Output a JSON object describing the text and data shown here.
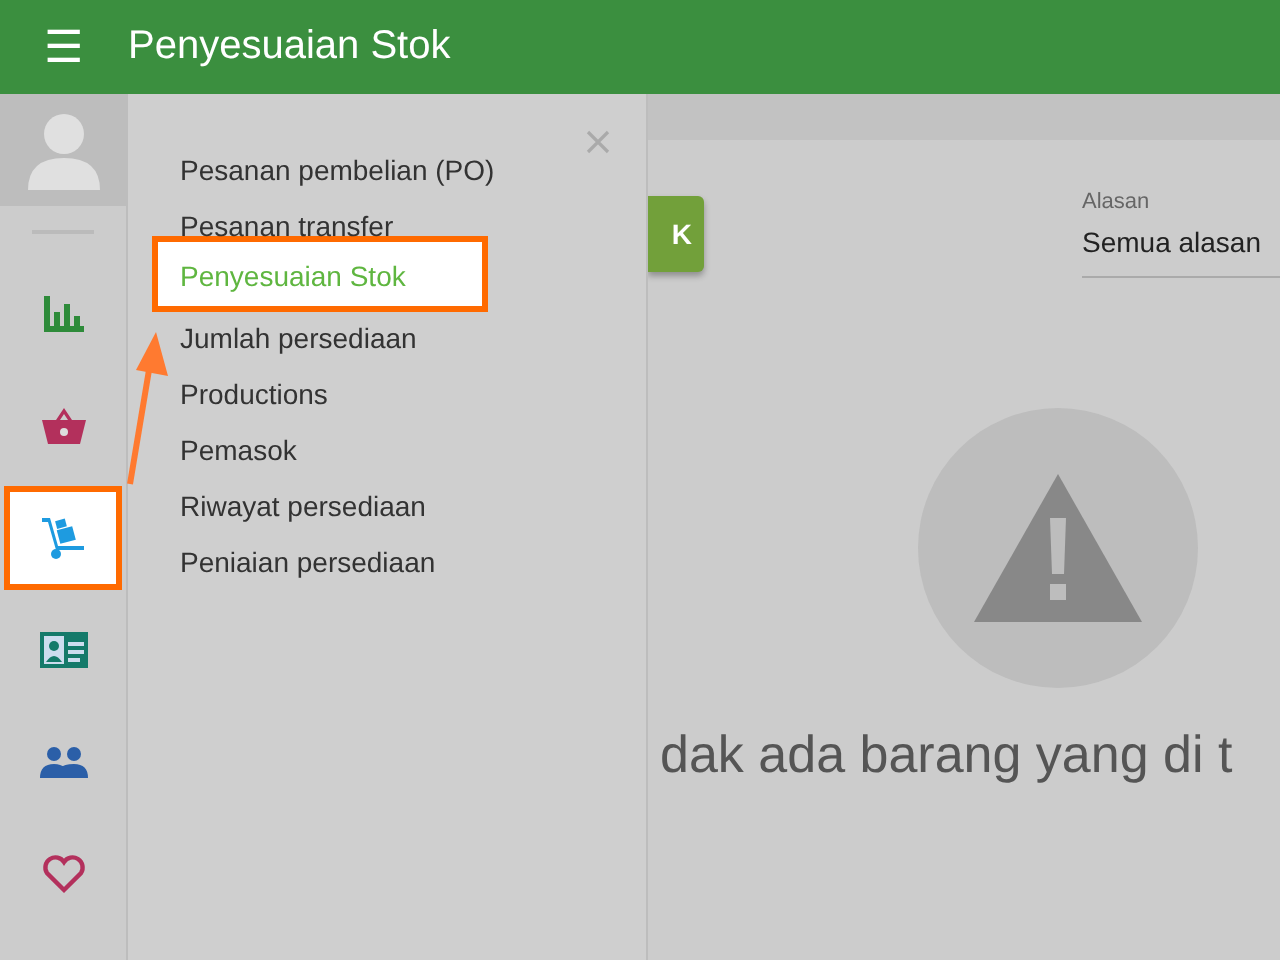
{
  "header": {
    "menu_icon": "☰",
    "title": "Penyesuaian Stok"
  },
  "rail": [
    {
      "kind": "chart",
      "selected": false
    },
    {
      "kind": "basket",
      "selected": false
    },
    {
      "kind": "cart",
      "selected": true
    },
    {
      "kind": "card",
      "selected": false
    },
    {
      "kind": "people",
      "selected": false
    },
    {
      "kind": "heart",
      "selected": false
    }
  ],
  "submenu": {
    "items": [
      {
        "label": "Pesanan pembelian (PO)",
        "selected": false
      },
      {
        "label": "Pesanan transfer",
        "selected": false
      },
      {
        "label": "Penyesuaian Stok",
        "selected": true
      },
      {
        "label": "Jumlah persediaan",
        "selected": false
      },
      {
        "label": "Productions",
        "selected": false
      },
      {
        "label": "Pemasok",
        "selected": false
      },
      {
        "label": "Riwayat persediaan",
        "selected": false
      },
      {
        "label": "Peniaian persediaan",
        "selected": false
      }
    ]
  },
  "main": {
    "button": "K",
    "filter": {
      "label": "Alasan",
      "value": "Semua alasan"
    },
    "empty_message": "dak ada barang yang di t"
  }
}
